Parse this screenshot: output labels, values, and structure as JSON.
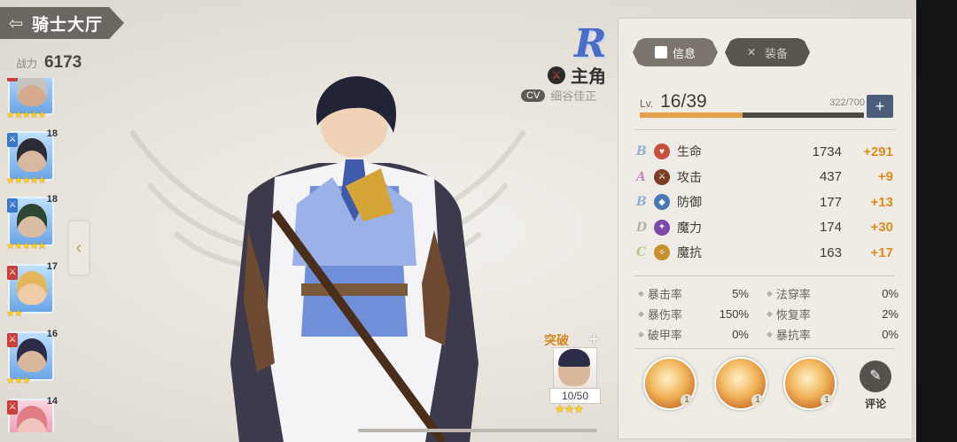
{
  "header": {
    "back_icon": "back-arrow-icon",
    "title": "骑士大厅"
  },
  "power": {
    "label": "战力",
    "value": "6173"
  },
  "roster": [
    {
      "level": "",
      "role": "sword-icon",
      "role_color": "blue",
      "stars": "★★★★★",
      "skin": "#d6a88c",
      "hair": "#c9c3c0"
    },
    {
      "level": "18",
      "role": "sword-icon",
      "role_color": "blue",
      "stars": "★★★★★",
      "skin": "#d9b8a0",
      "hair": "#2d2b35"
    },
    {
      "level": "18",
      "role": "sword-icon",
      "role_color": "blue",
      "stars": "★★★★★",
      "skin": "#d8bca3",
      "hair": "#2f4634"
    },
    {
      "level": "17",
      "role": "sword-icon",
      "role_color": "red",
      "stars": "★★",
      "skin": "#efcba8",
      "hair": "#e5b75c"
    },
    {
      "level": "16",
      "role": "sword-icon",
      "role_color": "red",
      "stars": "★★★",
      "skin": "#d9b79a",
      "hair": "#2c2c46"
    },
    {
      "level": "14",
      "role": "sword-icon",
      "role_color": "red",
      "stars": "",
      "skin": "#f2c4c0",
      "hair": "#e07d84"
    }
  ],
  "character": {
    "rarity": "R",
    "role_icon": "sword-class-icon",
    "name": "主角",
    "cv_tag": "CV",
    "voice_actor": "细谷佳正"
  },
  "breakthrough": {
    "label": "突破",
    "plus": "+",
    "count": "10/50",
    "stars": "★★★"
  },
  "panel": {
    "tabs": [
      {
        "label": "信息",
        "icon": "info-card-icon",
        "active": true
      },
      {
        "label": "装备",
        "icon": "crossed-swords-icon",
        "active": false
      }
    ],
    "level": {
      "prefix": "Lv.",
      "value": "16/39",
      "exp": "322/700",
      "progress": 0.46,
      "add_label": "+"
    },
    "stats": [
      {
        "grade": "B",
        "grade_color": "#8fb0d8",
        "icon": "heart-icon",
        "icon_color": "#c8503e",
        "name": "生命",
        "value": "1734",
        "bonus": "+291"
      },
      {
        "grade": "A",
        "grade_color": "#c48ac0",
        "icon": "attack-icon",
        "icon_color": "#7a3e24",
        "name": "攻击",
        "value": "437",
        "bonus": "+9"
      },
      {
        "grade": "B",
        "grade_color": "#8fb0d8",
        "icon": "shield-icon",
        "icon_color": "#4a78b4",
        "name": "防御",
        "value": "177",
        "bonus": "+13"
      },
      {
        "grade": "D",
        "grade_color": "#b8b0a8",
        "icon": "magic-icon",
        "icon_color": "#7c4aa8",
        "name": "魔力",
        "value": "174",
        "bonus": "+30"
      },
      {
        "grade": "C",
        "grade_color": "#b0cc88",
        "icon": "magic-resist-icon",
        "icon_color": "#c8902e",
        "name": "魔抗",
        "value": "163",
        "bonus": "+17"
      }
    ],
    "sub_stats": [
      [
        {
          "name": "暴击率",
          "value": "5%"
        },
        {
          "name": "法穿率",
          "value": "0%"
        }
      ],
      [
        {
          "name": "暴伤率",
          "value": "150%"
        },
        {
          "name": "恢复率",
          "value": "2%"
        }
      ],
      [
        {
          "name": "破甲率",
          "value": "0%"
        },
        {
          "name": "暴抗率",
          "value": "0%"
        }
      ]
    ],
    "skills": [
      {
        "icon": "skill-shield-icon",
        "level": "1"
      },
      {
        "icon": "skill-sword-icon",
        "level": "1"
      },
      {
        "icon": "skill-handshake-icon",
        "level": "1"
      }
    ],
    "comment": {
      "icon": "pen-icon",
      "label": "评论"
    }
  }
}
